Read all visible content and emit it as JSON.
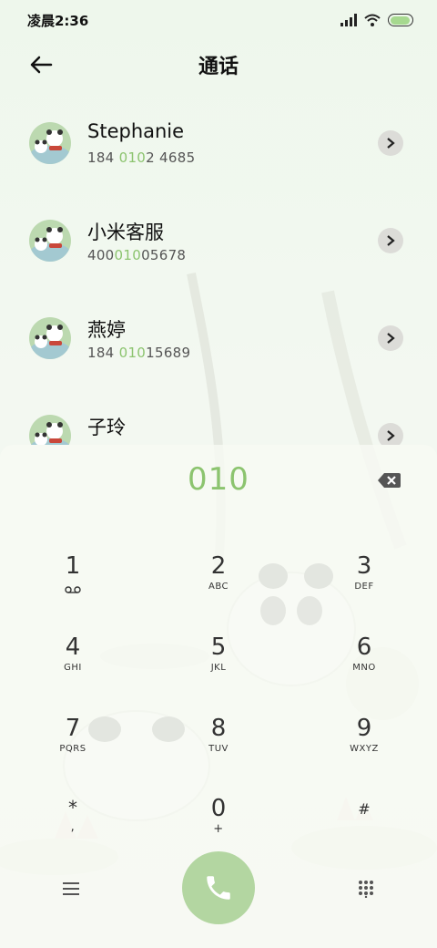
{
  "status_bar": {
    "time": "凌晨2:36",
    "battery_level": 0.95
  },
  "header": {
    "title": "通话",
    "back_icon": "arrow-left-icon"
  },
  "contacts": [
    {
      "name": "Stephanie",
      "number_before": "184 ",
      "number_match": "010",
      "number_after": "2 4685"
    },
    {
      "name": "小米客服",
      "number_before": "400",
      "number_match": "010",
      "number_after": "05678"
    },
    {
      "name": "燕婷",
      "number_before": "184 ",
      "number_match": "010",
      "number_after": "15689"
    },
    {
      "name": "子玲",
      "number_before": "",
      "number_match": "",
      "number_after": ""
    }
  ],
  "dialer": {
    "input": "010",
    "keys": [
      {
        "digit": "1",
        "letters": ""
      },
      {
        "digit": "2",
        "letters": "ABC"
      },
      {
        "digit": "3",
        "letters": "DEF"
      },
      {
        "digit": "4",
        "letters": "GHI"
      },
      {
        "digit": "5",
        "letters": "JKL"
      },
      {
        "digit": "6",
        "letters": "MNO"
      },
      {
        "digit": "7",
        "letters": "PQRS"
      },
      {
        "digit": "8",
        "letters": "TUV"
      },
      {
        "digit": "9",
        "letters": "WXYZ"
      },
      {
        "digit": "*",
        "letters": ","
      },
      {
        "digit": "0",
        "letters": "+"
      },
      {
        "digit": "#",
        "letters": ""
      }
    ]
  },
  "colors": {
    "match_highlight": "#8cc46f",
    "call_button": "#b3d6a1"
  }
}
